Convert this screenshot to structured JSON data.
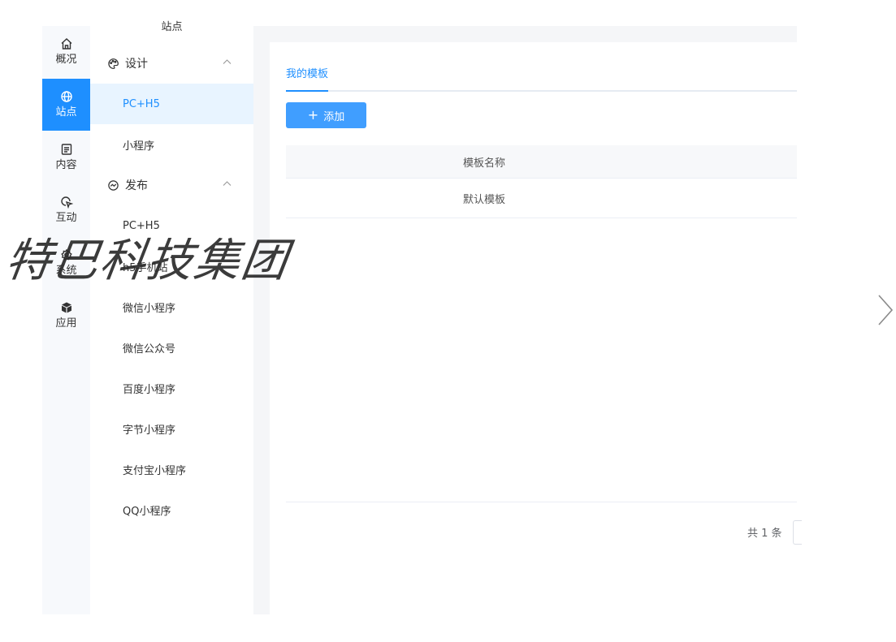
{
  "rail": {
    "items": [
      {
        "label": "概况",
        "icon": "home-icon"
      },
      {
        "label": "站点",
        "icon": "globe-icon"
      },
      {
        "label": "内容",
        "icon": "document-icon"
      },
      {
        "label": "互动",
        "icon": "pointer-icon"
      },
      {
        "label": "系统",
        "icon": "gear-icon"
      },
      {
        "label": "应用",
        "icon": "box-icon"
      }
    ],
    "active_index": 1
  },
  "submenu": {
    "title": "站点",
    "groups": [
      {
        "label": "设计",
        "icon": "palette-icon",
        "items": [
          "PC+H5",
          "小程序"
        ]
      },
      {
        "label": "发布",
        "icon": "publish-icon",
        "items": [
          "PC+H5",
          "h5手机站",
          "微信小程序",
          "微信公众号",
          "百度小程序",
          "字节小程序",
          "支付宝小程序",
          "QQ小程序"
        ]
      }
    ],
    "active_item": "设计 / PC+H5"
  },
  "main": {
    "tab_label": "我的模板",
    "add_button_label": "添加",
    "table": {
      "columns": [
        "模板名称"
      ],
      "rows": [
        [
          "默认模板"
        ]
      ]
    },
    "total_text": "共 1 条"
  },
  "watermark": "特巴科技集团",
  "colors": {
    "accent": "#1e8fff",
    "button": "#409eff",
    "active_bg": "#e8f4ff"
  }
}
